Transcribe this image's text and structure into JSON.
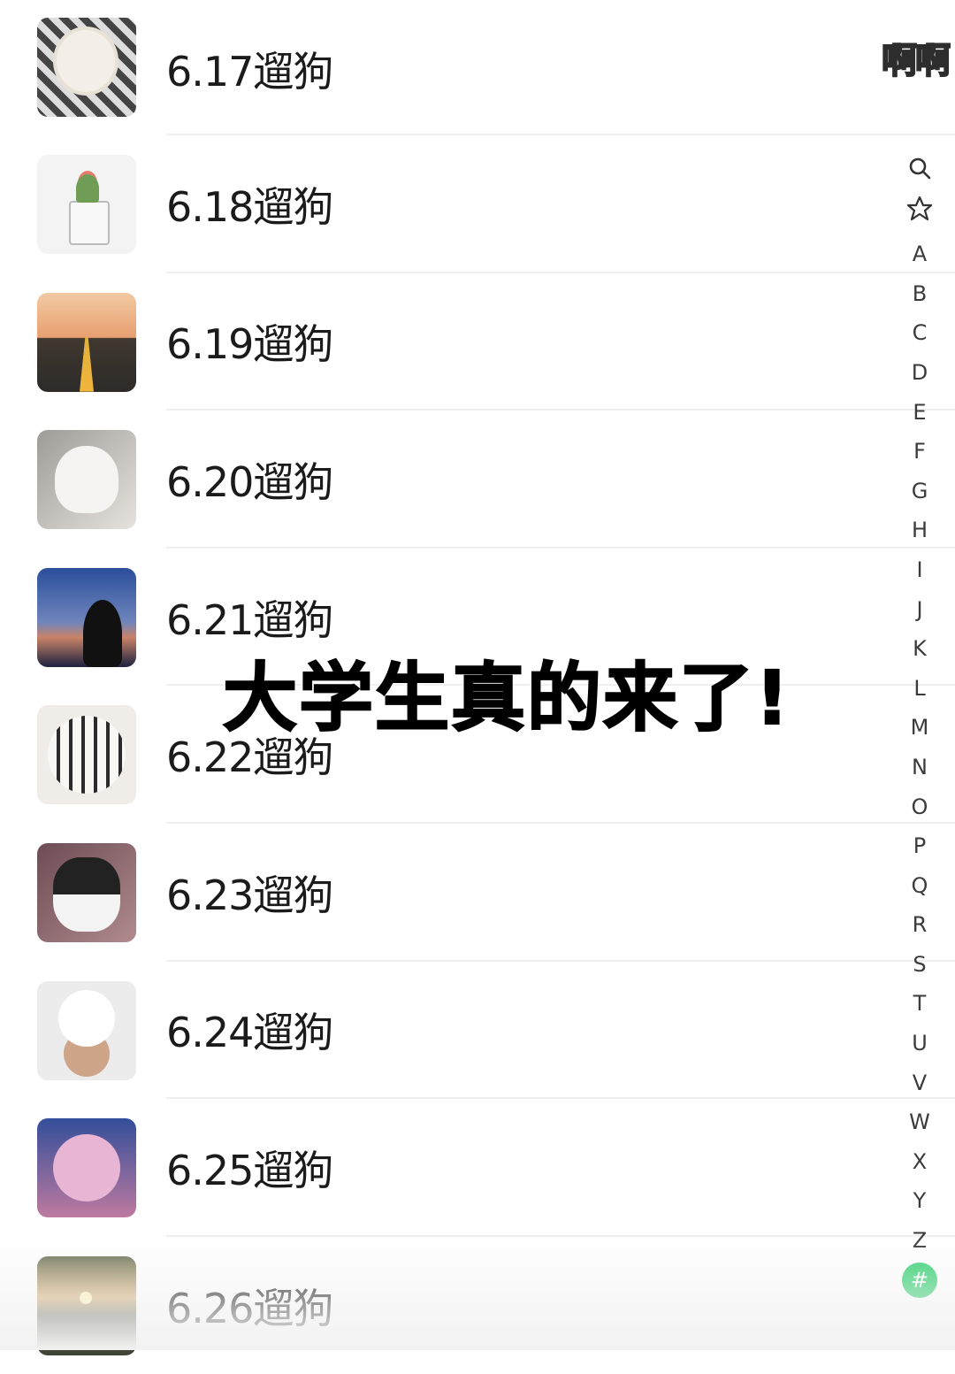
{
  "watermark": "啊啊",
  "overlay_caption": "大学生真的来了!",
  "contacts": [
    {
      "name": "6.17遛狗",
      "avatar": "sheep-plush-avatar"
    },
    {
      "name": "6.18遛狗",
      "avatar": "potted-plant-avatar"
    },
    {
      "name": "6.19遛狗",
      "avatar": "palm-road-avatar"
    },
    {
      "name": "6.20遛狗",
      "avatar": "white-cat-avatar"
    },
    {
      "name": "6.21遛狗",
      "avatar": "sunset-man-avatar"
    },
    {
      "name": "6.22遛狗",
      "avatar": "tiger-plush-avatar"
    },
    {
      "name": "6.23遛狗",
      "avatar": "cat-plush-avatar"
    },
    {
      "name": "6.24遛狗",
      "avatar": "white-dog-avatar"
    },
    {
      "name": "6.25遛狗",
      "avatar": "anime-girl-avatar"
    },
    {
      "name": "6.26遛狗",
      "avatar": "sunset-trees-avatar"
    }
  ],
  "index": {
    "icons": [
      "search-icon",
      "star-icon"
    ],
    "letters": [
      "A",
      "B",
      "C",
      "D",
      "E",
      "F",
      "G",
      "H",
      "I",
      "J",
      "K",
      "L",
      "M",
      "N",
      "O",
      "P",
      "Q",
      "R",
      "S",
      "T",
      "U",
      "V",
      "W",
      "X",
      "Y",
      "Z"
    ],
    "hash": "#",
    "hash_color": "#2fcf6d"
  }
}
